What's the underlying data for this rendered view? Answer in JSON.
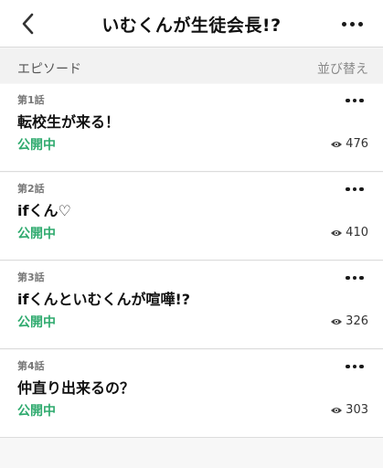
{
  "header": {
    "title": "いむくんが生徒会長!?",
    "back_icon": "chevron-left-icon",
    "more_icon": "more-horizontal-icon"
  },
  "section": {
    "label": "エピソード",
    "sort_label": "並び替え"
  },
  "episodes": [
    {
      "number": "第1話",
      "title": "転校生が来る！",
      "status": "公開中",
      "views": "476"
    },
    {
      "number": "第2話",
      "title": "ifくん♡",
      "status": "公開中",
      "views": "410"
    },
    {
      "number": "第3話",
      "title": "ifくんといむくんが喧嘩!?",
      "status": "公開中",
      "views": "326"
    },
    {
      "number": "第4話",
      "title": "仲直り出来るの？",
      "status": "公開中",
      "views": "303"
    }
  ],
  "colors": {
    "status_green": "#2eaa6e",
    "background": "#f7f7f7"
  }
}
